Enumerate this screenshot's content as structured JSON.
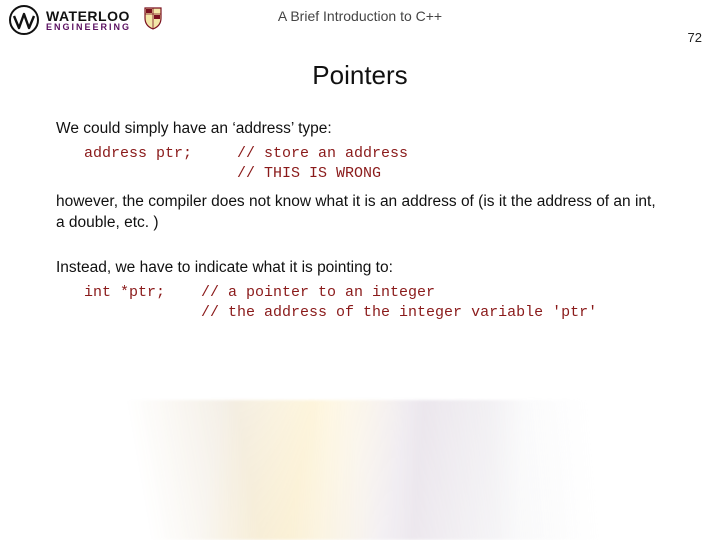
{
  "header": {
    "logo_top": "WATERLOO",
    "logo_bottom": "ENGINEERING",
    "doc_subtitle": "A Brief Introduction to C++",
    "page_number": "72"
  },
  "title": "Pointers",
  "body": {
    "p1": "We could simply have an ‘address’ type:",
    "code1": "address ptr;     // store an address\n                 // THIS IS WRONG",
    "p2": "however, the compiler does not know what it is an address of (is it the address of an int, a double, etc. )",
    "p3": "Instead, we have to indicate what it is pointing to:",
    "code2": "int *ptr;    // a pointer to an integer\n             // the address of the integer variable 'ptr'"
  }
}
